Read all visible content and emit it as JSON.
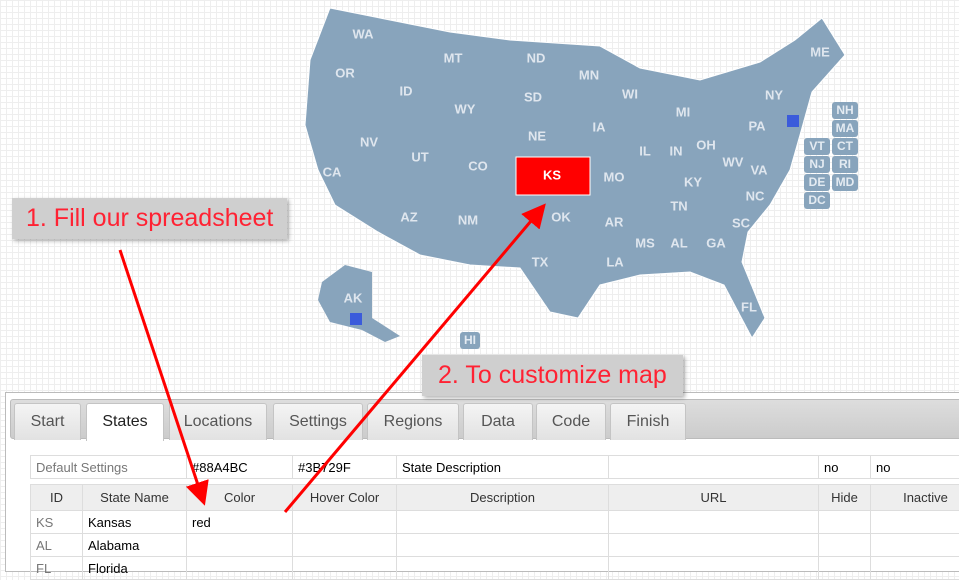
{
  "map": {
    "default_color": "#88A4BC",
    "highlight_color": "#FF0000",
    "marker_color": "#3B5BDB",
    "states": [
      [
        "WA",
        363,
        34
      ],
      [
        "OR",
        345,
        73
      ],
      [
        "ID",
        406,
        91
      ],
      [
        "MT",
        453,
        58
      ],
      [
        "ND",
        536,
        58
      ],
      [
        "MN",
        589,
        75
      ],
      [
        "SD",
        533,
        97
      ],
      [
        "WY",
        465,
        109
      ],
      [
        "WI",
        630,
        94
      ],
      [
        "MI",
        683,
        112
      ],
      [
        "NY",
        774,
        95
      ],
      [
        "ME",
        820,
        52
      ],
      [
        "NE",
        537,
        136
      ],
      [
        "IA",
        599,
        127
      ],
      [
        "NV",
        369,
        142
      ],
      [
        "UT",
        420,
        157
      ],
      [
        "CO",
        478,
        166
      ],
      [
        "IL",
        645,
        151
      ],
      [
        "IN",
        676,
        151
      ],
      [
        "OH",
        706,
        145
      ],
      [
        "PA",
        757,
        126
      ],
      [
        "CA",
        332,
        172
      ],
      [
        "MO",
        614,
        177
      ],
      [
        "KY",
        693,
        182
      ],
      [
        "WV",
        733,
        162
      ],
      [
        "VA",
        759,
        170
      ],
      [
        "OK",
        561,
        217
      ],
      [
        "NC",
        755,
        196
      ],
      [
        "TN",
        679,
        206
      ],
      [
        "AZ",
        409,
        217
      ],
      [
        "NM",
        468,
        220
      ],
      [
        "AR",
        614,
        222
      ],
      [
        "SC",
        741,
        223
      ],
      [
        "MS",
        645,
        243
      ],
      [
        "AL",
        679,
        243
      ],
      [
        "GA",
        716,
        243
      ],
      [
        "TX",
        540,
        262
      ],
      [
        "LA",
        615,
        262
      ],
      [
        "FL",
        749,
        307
      ],
      [
        "AK",
        353,
        298
      ]
    ],
    "highlighted": "KS",
    "hawaii": "HI",
    "small_states": [
      [
        "NH",
        832,
        102
      ],
      [
        "MA",
        832,
        120
      ],
      [
        "VT",
        804,
        138
      ],
      [
        "CT",
        832,
        138
      ],
      [
        "NJ",
        804,
        156
      ],
      [
        "RI",
        832,
        156
      ],
      [
        "DE",
        804,
        174
      ],
      [
        "MD",
        832,
        174
      ],
      [
        "DC",
        804,
        192
      ]
    ]
  },
  "callouts": {
    "step1": "1. Fill our spreadsheet",
    "step2": "2.  To customize map"
  },
  "tabs": [
    "Start",
    "States",
    "Locations",
    "Settings",
    "Regions",
    "Data",
    "Code",
    "Finish"
  ],
  "active_tab": "States",
  "defaults": [
    "Default Settings",
    "#88A4BC",
    "#3B729F",
    "State Description",
    "",
    "no",
    "no"
  ],
  "columns": [
    "ID",
    "State Name",
    "Color",
    "Hover Color",
    "Description",
    "URL",
    "Hide",
    "Inactive"
  ],
  "rows": [
    [
      "KS",
      "Kansas",
      "red",
      "",
      "",
      "",
      "",
      ""
    ],
    [
      "AL",
      "Alabama",
      "",
      "",
      "",
      "",
      "",
      ""
    ],
    [
      "FL",
      "Florida",
      "",
      "",
      "",
      "",
      "",
      ""
    ]
  ]
}
